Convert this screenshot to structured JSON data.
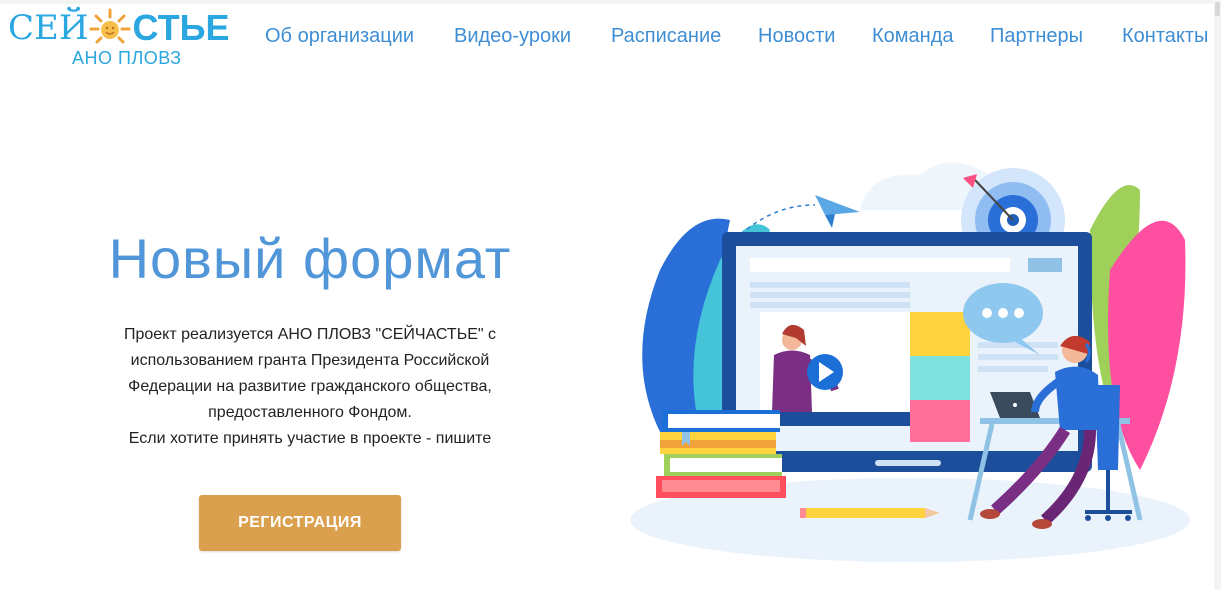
{
  "brand": {
    "logo_prefix": "СЕЙ",
    "logo_suffix": "СТЬЕ",
    "logo_subtitle": "АНО ПЛОВЗ",
    "colors": {
      "brand_blue": "#2aa6e0",
      "sun_orange": "#f2a23a"
    }
  },
  "nav": {
    "items": [
      {
        "label": "Об организации"
      },
      {
        "label": "Видео-уроки"
      },
      {
        "label": "Расписание"
      },
      {
        "label": "Новости"
      },
      {
        "label": "Команда"
      },
      {
        "label": "Партнеры"
      },
      {
        "label": "Контакты"
      }
    ],
    "color": "#3f8ed4"
  },
  "hero": {
    "title": "Новый формат",
    "text_lines": [
      "Проект реализуется АНО ПЛОВЗ \"СЕЙЧАСТЬЕ\" с",
      "использованием гранта Президента Российской",
      "Федерации на развитие гражданского общества,",
      "предоставленного Фондом.",
      "Если хотите принять участие в проекте - пишите"
    ],
    "button_label": "РЕГИСТРАЦИЯ",
    "colors": {
      "title": "#5096d8",
      "button": "#dba04d"
    }
  },
  "illustration": {
    "icons": [
      "paper-plane-icon",
      "target-icon",
      "play-icon",
      "chat-bubble-icon",
      "laptop-icon",
      "books-icon",
      "pencil-icon"
    ]
  }
}
